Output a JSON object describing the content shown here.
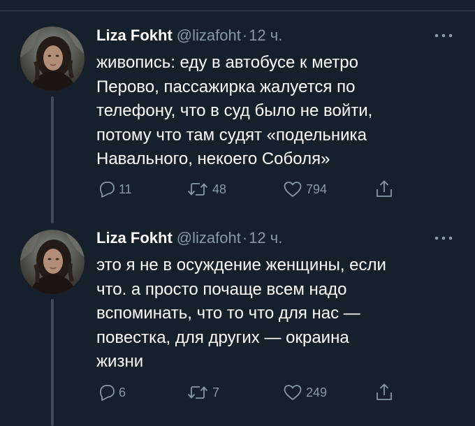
{
  "tweets": [
    {
      "display_name": "Liza Fokht",
      "handle": "@lizafoht",
      "separator": "·",
      "time": "12 ч.",
      "text_lines": [
        "живопись: еду в автобусе к метро",
        "Перово, пассажирка жалуется по",
        "телефону, что в суд было не войти,",
        "потому что там судят «подельника",
        "Навального, некоего Соболя»"
      ],
      "reply_count": "11",
      "retweet_count": "48",
      "like_count": "794"
    },
    {
      "display_name": "Liza Fokht",
      "handle": "@lizafoht",
      "separator": "·",
      "time": "12 ч.",
      "text_lines": [
        "это я не в осуждение женщины, если",
        "что. а просто почаще всем надо",
        "вспоминать, что то что для нас —",
        "повестка, для других — окраина",
        "жизни"
      ],
      "reply_count": "6",
      "retweet_count": "7",
      "like_count": "249"
    }
  ],
  "icons": {
    "more": "more-horizontal-icon",
    "reply": "reply-icon",
    "retweet": "retweet-icon",
    "like": "heart-icon",
    "share": "share-icon"
  },
  "colors": {
    "background": "#15202b",
    "text": "#ffffff",
    "secondary": "#8899a6",
    "divider": "#38444d"
  }
}
